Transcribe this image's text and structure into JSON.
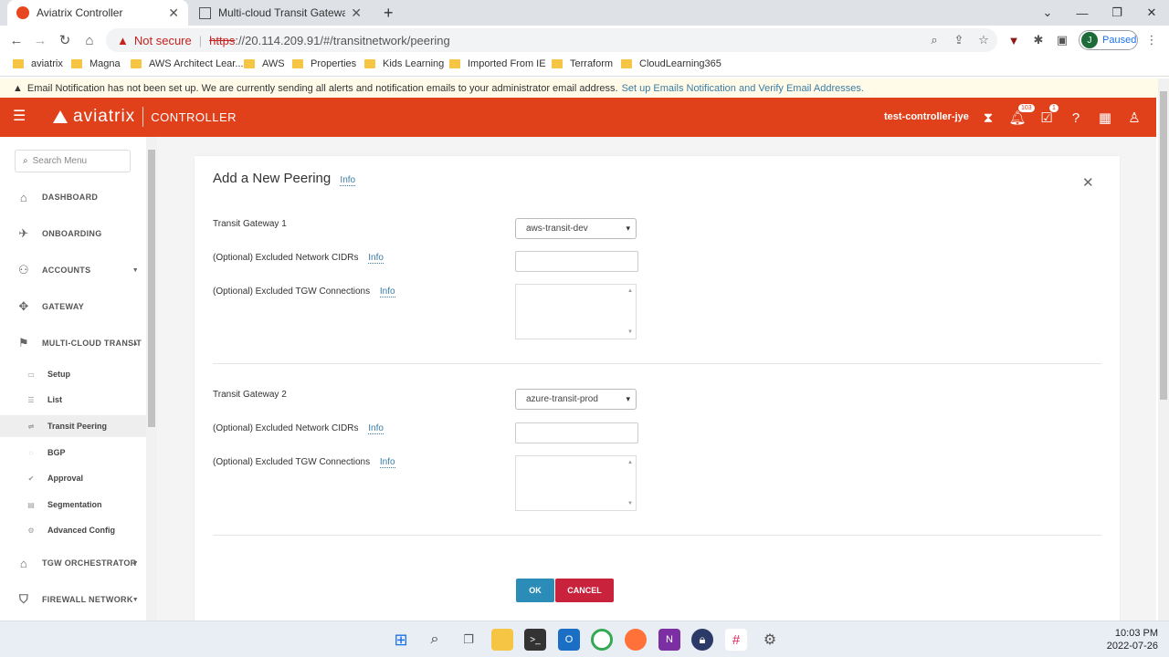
{
  "browser": {
    "tabs": [
      {
        "title": "Aviatrix Controller",
        "active": true
      },
      {
        "title": "Multi-cloud Transit Gateway Pee",
        "active": false
      }
    ],
    "new_tab": "+",
    "address": {
      "warning": "Not secure",
      "scheme": "https",
      "url": "://20.114.209.91/#/transitnetwork/peering"
    },
    "profile": {
      "initial": "J",
      "status": "Paused"
    },
    "bookmarks": [
      "aviatrix",
      "Magna",
      "AWS Architect Lear...",
      "AWS",
      "Properties",
      "Kids Learning",
      "Imported From IE",
      "Terraform",
      "CloudLearning365"
    ]
  },
  "notification": {
    "text": "Email Notification has not been set up. We are currently sending all alerts and notification emails to your administrator email address.",
    "link": "Set up Emails Notification and Verify Email Addresses."
  },
  "header": {
    "brand": "aviatrix",
    "product": "CONTROLLER",
    "controller_name": "test-controller-jye",
    "notifications_count": "103",
    "tasks_count": "1"
  },
  "sidebar": {
    "search_placeholder": "Search Menu",
    "items": [
      {
        "label": "DASHBOARD"
      },
      {
        "label": "ONBOARDING"
      },
      {
        "label": "ACCOUNTS"
      },
      {
        "label": "GATEWAY"
      },
      {
        "label": "MULTI-CLOUD TRANSIT"
      },
      {
        "label": "TGW ORCHESTRATOR"
      },
      {
        "label": "FIREWALL NETWORK"
      }
    ],
    "subitems": [
      {
        "label": "Setup"
      },
      {
        "label": "List"
      },
      {
        "label": "Transit Peering"
      },
      {
        "label": "BGP"
      },
      {
        "label": "Approval"
      },
      {
        "label": "Segmentation"
      },
      {
        "label": "Advanced Config"
      }
    ]
  },
  "form": {
    "title": "Add a New Peering",
    "info": "Info",
    "gw1": {
      "label": "Transit Gateway 1",
      "value": "aws-transit-dev",
      "cidr_label": "(Optional) Excluded Network CIDRs",
      "tgw_label": "(Optional) Excluded TGW Connections"
    },
    "gw2": {
      "label": "Transit Gateway 2",
      "value": "azure-transit-prod",
      "cidr_label": "(Optional) Excluded Network CIDRs",
      "tgw_label": "(Optional) Excluded TGW Connections"
    },
    "ok": "OK",
    "cancel": "CANCEL"
  },
  "taskbar": {
    "time": "10:03 PM",
    "date": "2022-07-26"
  },
  "colors": {
    "brand": "#e0411b",
    "ok": "#2b8cb8",
    "cancel": "#c8223d"
  }
}
